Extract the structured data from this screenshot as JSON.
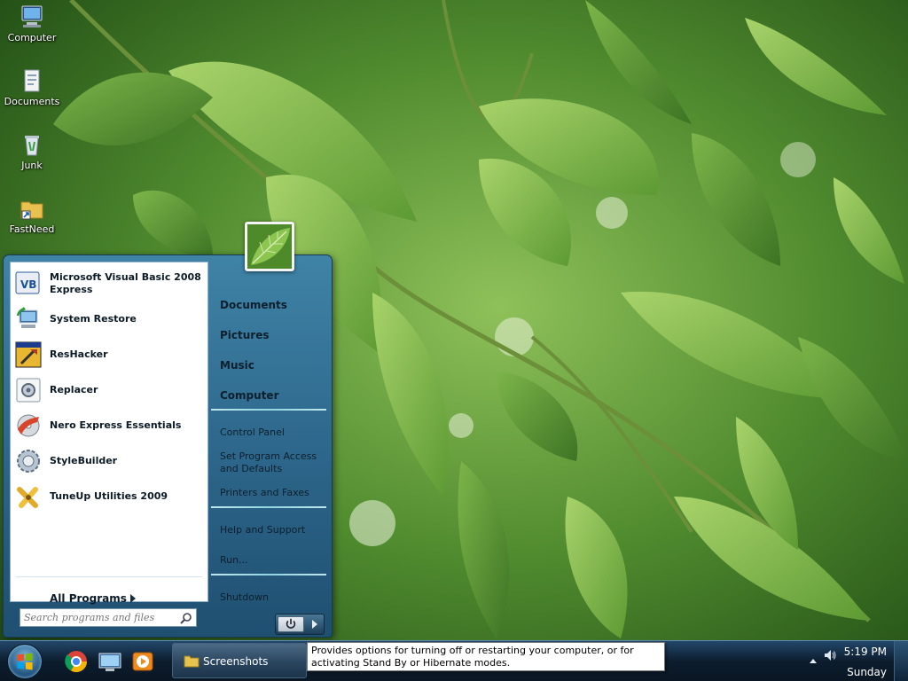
{
  "desktop": {
    "icons": [
      {
        "label": "Computer",
        "icon": "computer-icon"
      },
      {
        "label": "Documents",
        "icon": "documents-icon"
      },
      {
        "label": "Junk",
        "icon": "recycle-bin-icon"
      },
      {
        "label": "FastNeed",
        "icon": "folder-shortcut-icon"
      }
    ]
  },
  "start_menu": {
    "programs": [
      {
        "label": "Microsoft Visual Basic 2008 Express",
        "icon": "visual-basic-icon"
      },
      {
        "label": "System Restore",
        "icon": "system-restore-icon"
      },
      {
        "label": "ResHacker",
        "icon": "reshacker-icon"
      },
      {
        "label": "Replacer",
        "icon": "replacer-icon"
      },
      {
        "label": "Nero Express Essentials",
        "icon": "nero-icon"
      },
      {
        "label": "StyleBuilder",
        "icon": "stylebuilder-icon"
      },
      {
        "label": "TuneUp Utilities 2009",
        "icon": "tuneup-icon"
      }
    ],
    "all_programs": "All Programs",
    "search": {
      "placeholder": "Search programs and files"
    },
    "places": {
      "documents": "Documents",
      "pictures": "Pictures",
      "music": "Music",
      "computer": "Computer",
      "control_panel": "Control Panel",
      "set_program_access": "Set Program Access and Defaults",
      "printers": "Printers and Faxes",
      "help": "Help and Support",
      "run": "Run...",
      "shutdown": "Shutdown"
    },
    "power_icon": "power-icon",
    "arrow_icon": "arrow-right-icon"
  },
  "taskbar": {
    "quick_launch": [
      "chrome-icon",
      "show-desktop-icon",
      "media-player-icon"
    ],
    "windows": [
      {
        "label": "Screenshots",
        "icon": "folder-icon"
      }
    ],
    "tooltip": "Provides options for turning off or restarting your computer, or for activating Stand By or Hibernate modes.",
    "clock": {
      "time": "5:19 PM",
      "day": "Sunday"
    }
  },
  "colors": {
    "menu_frame": "#2c6589",
    "taskbar": "#0c1d2e",
    "separator_accent": "#8fd6e0"
  }
}
